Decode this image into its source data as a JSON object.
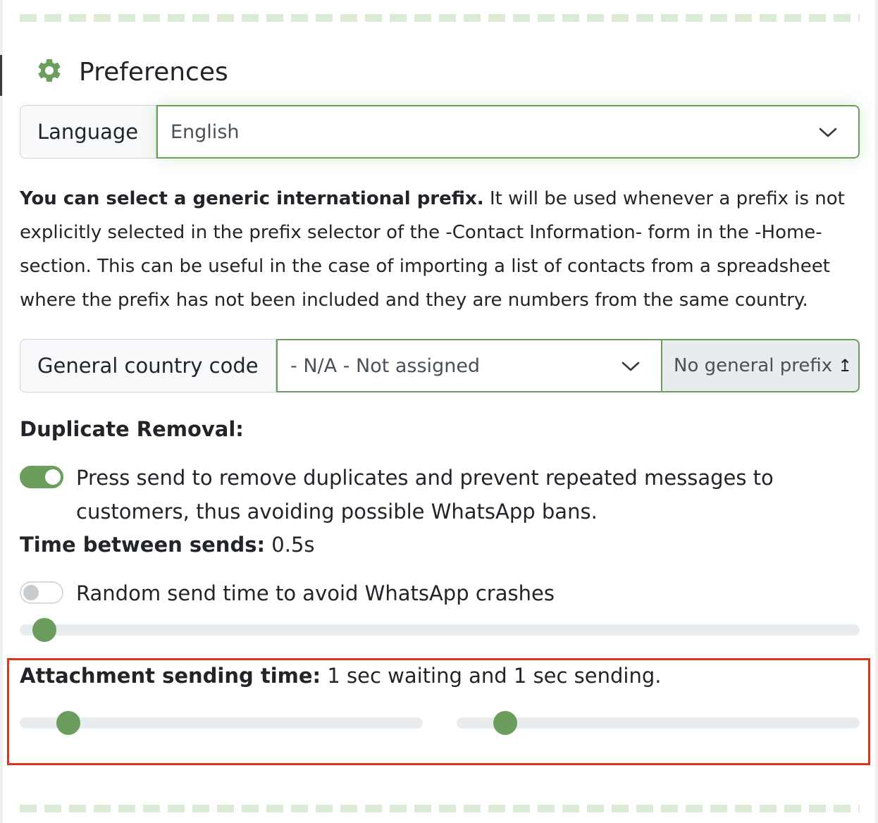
{
  "header": {
    "title": "Preferences",
    "icon": "gear-icon",
    "accent_color": "#6b9e5d"
  },
  "language": {
    "label": "Language",
    "selected": "English"
  },
  "prefix_info": {
    "bold": "You can select a generic international prefix.",
    "text": " It will be used whenever a prefix is not explicitly selected in the prefix selector of the -Contact Information- form in the -Home- section. This can be useful in the case of importing a list of contacts from a spreadsheet where the prefix has not been included and they are numbers from the same country."
  },
  "country_code": {
    "label": "General country code",
    "selected": "- N/A - Not assigned",
    "button_label": "No general prefix",
    "button_icon": "↥"
  },
  "duplicate_removal": {
    "heading": "Duplicate Removal:",
    "toggle_text": "Press send to remove duplicates and prevent repeated messages to customers, thus avoiding possible WhatsApp bans.",
    "enabled": true
  },
  "time_between_sends": {
    "label": "Time between sends:",
    "value": " 0.5s",
    "random_toggle_text": "Random send time to avoid WhatsApp crashes",
    "random_enabled": false,
    "slider_fraction": 0.029
  },
  "attachment": {
    "label": "Attachment sending time:",
    "value": " 1 sec waiting and 1 sec sending.",
    "waiting_slider_fraction": 0.12,
    "sending_slider_fraction": 0.12,
    "highlight_color": "#d9361e"
  }
}
